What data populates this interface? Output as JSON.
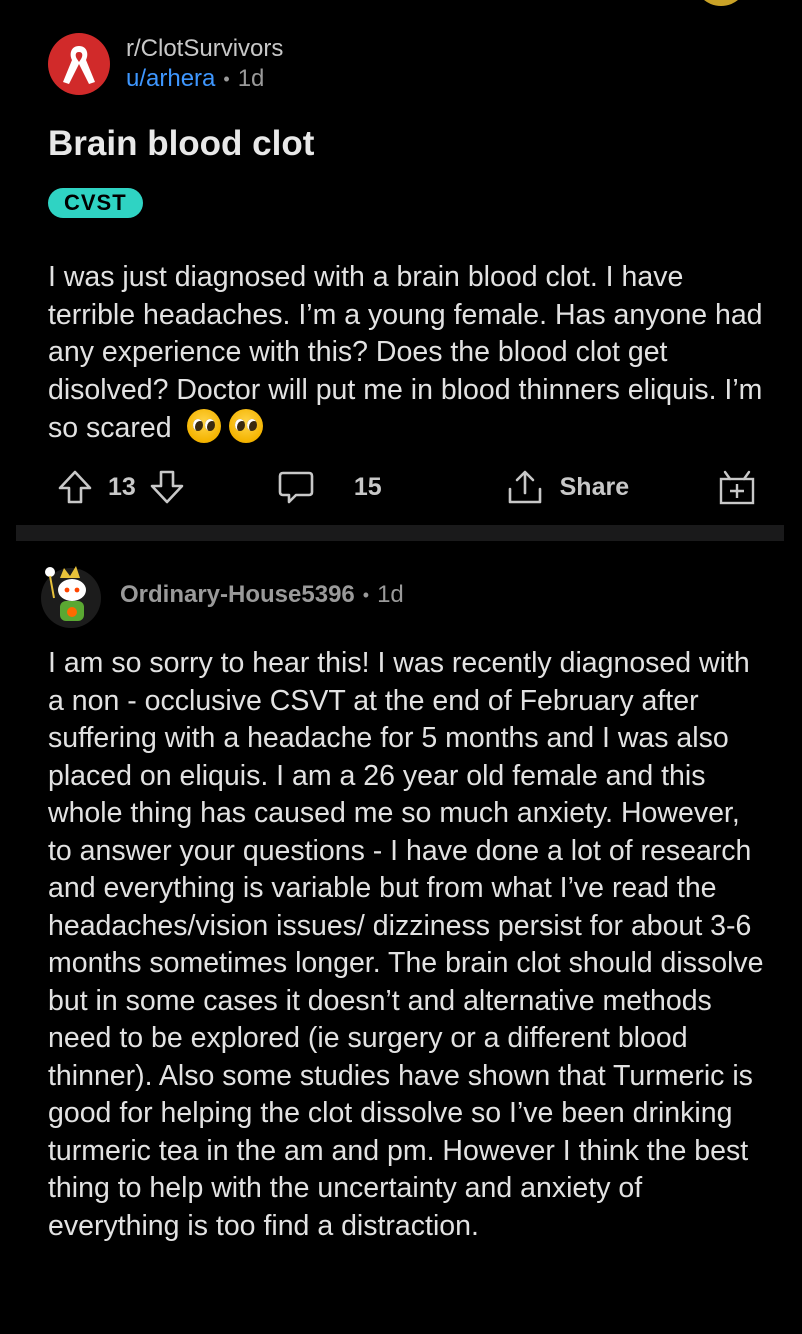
{
  "post": {
    "subreddit": "r/ClotSurvivors",
    "author": "u/arhera",
    "age": "1d",
    "title": "Brain blood clot",
    "flair": "CVST",
    "body": "I was just diagnosed with a brain blood clot. I have terrible headaches. I’m a young female. Has anyone had any experience with this? Does the blood clot get disolved? Doctor will put me in blood thinners eliquis. I’m so scared",
    "emojis": [
      "pleading-face-emoji",
      "pleading-face-emoji"
    ],
    "upvotes": "13",
    "comments": "15",
    "share_label": "Share"
  },
  "comment": {
    "author": "Ordinary-House5396",
    "age": "1d",
    "body": "I am so sorry to hear this! I was recently diagnosed with a non - occlusive CSVT at the end of February after suffering with a headache for 5 months and I was also placed on eliquis. I am a 26 year old female and this whole thing has caused me so much anxiety. However, to answer your questions - I have done a lot of research and everything is variable but from what I’ve read the headaches/vision issues/ dizziness persist for about 3-6 months sometimes longer. The brain clot should dissolve but in some cases it doesn’t and alternative methods need to be explored (ie surgery or a different blood thinner). Also some studies have shown that Turmeric is good for helping the clot dissolve so I’ve been drinking turmeric tea in the am and pm. However I think the best thing to help with the uncertainty and anxiety of everything is too find a distraction."
  },
  "colors": {
    "background": "#000000",
    "author_link": "#3e97ff",
    "flair_bg": "#2fd3c3",
    "subreddit_icon": "#d12a2a"
  }
}
